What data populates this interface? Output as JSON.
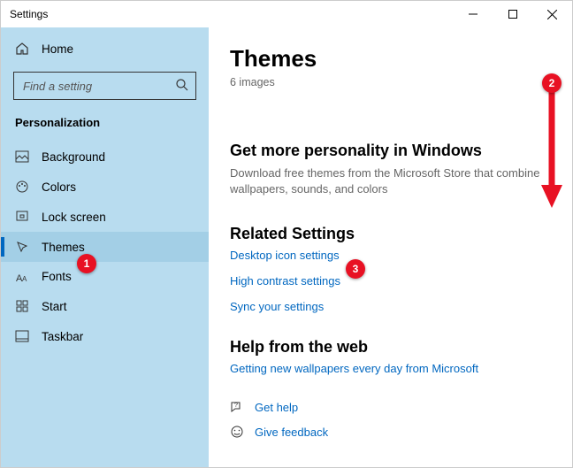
{
  "titlebar": {
    "title": "Settings"
  },
  "sidebar": {
    "home": "Home",
    "search_placeholder": "Find a setting",
    "section": "Personalization",
    "items": [
      {
        "label": "Background"
      },
      {
        "label": "Colors"
      },
      {
        "label": "Lock screen"
      },
      {
        "label": "Themes"
      },
      {
        "label": "Fonts"
      },
      {
        "label": "Start"
      },
      {
        "label": "Taskbar"
      }
    ]
  },
  "main": {
    "title": "Themes",
    "subtitle": "6 images",
    "promo_heading": "Get more personality in Windows",
    "promo_text": "Download free themes from the Microsoft Store that combine wallpapers, sounds, and colors",
    "related_heading": "Related Settings",
    "related_links": [
      "Desktop icon settings",
      "High contrast settings",
      "Sync your settings"
    ],
    "help_heading": "Help from the web",
    "help_links": [
      "Getting new wallpapers every day from Microsoft"
    ],
    "footer_links": [
      "Get help",
      "Give feedback"
    ]
  },
  "annotations": {
    "badge1": "1",
    "badge2": "2",
    "badge3": "3"
  }
}
